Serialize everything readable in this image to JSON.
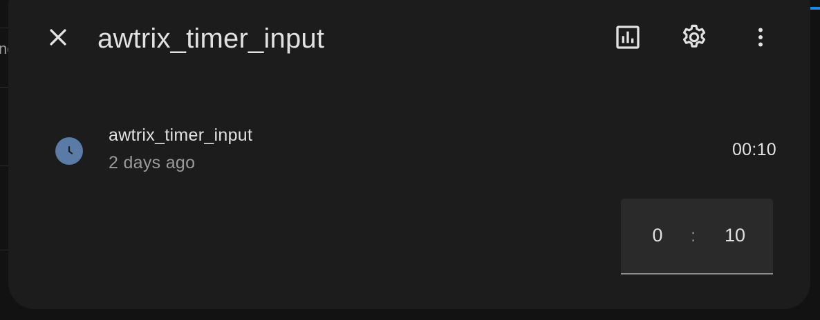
{
  "background": {
    "fragment_text": "ne"
  },
  "dialog": {
    "title": "awtrix_timer_input",
    "icons": {
      "close": "close-icon",
      "history": "chart-box-outline-icon",
      "settings": "gear-icon",
      "more": "dots-vertical-icon"
    }
  },
  "entity": {
    "icon": "clock-icon",
    "icon_color": "#5a7ba6",
    "name": "awtrix_timer_input",
    "last_changed": "2 days ago",
    "state": "00:10"
  },
  "time_input": {
    "hours": "0",
    "separator": ":",
    "minutes": "10"
  }
}
